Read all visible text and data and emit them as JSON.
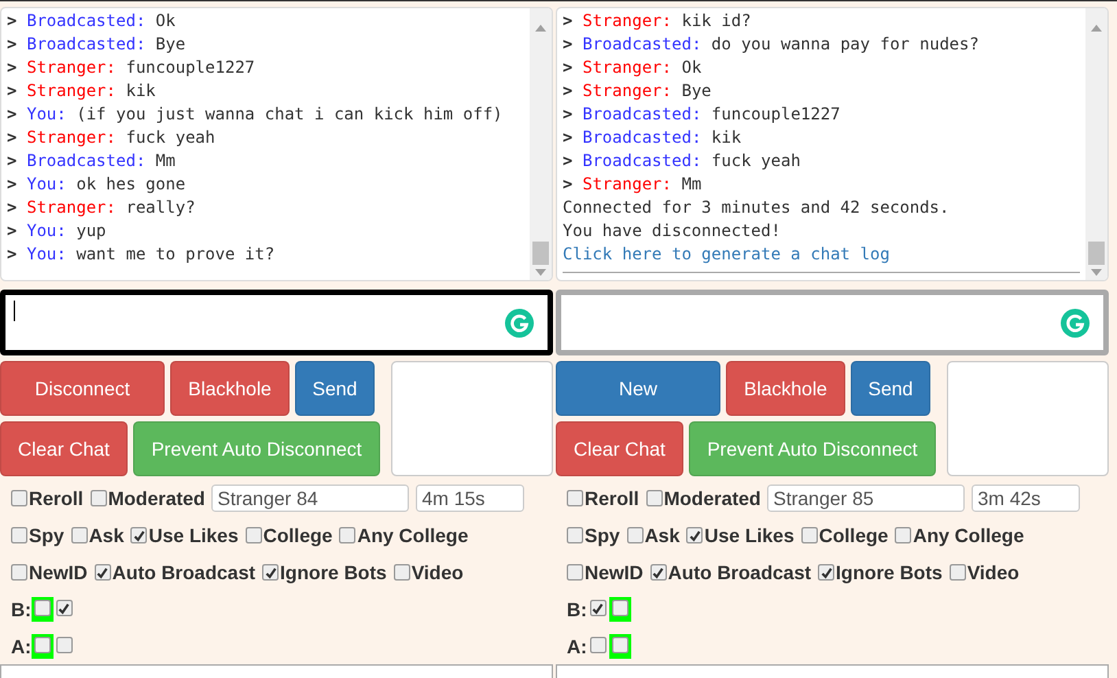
{
  "panels": [
    {
      "log": [
        {
          "kind": "broadcast",
          "prompt": ">",
          "sender": "Broadcasted:",
          "text": "Ok"
        },
        {
          "kind": "broadcast",
          "prompt": ">",
          "sender": "Broadcasted:",
          "text": "Bye"
        },
        {
          "kind": "stranger",
          "prompt": ">",
          "sender": "Stranger:",
          "text": "funcouple1227"
        },
        {
          "kind": "stranger",
          "prompt": ">",
          "sender": "Stranger:",
          "text": "kik"
        },
        {
          "kind": "you",
          "prompt": ">",
          "sender": "You:",
          "text": "(if you just wanna chat i can kick him off)"
        },
        {
          "kind": "stranger",
          "prompt": ">",
          "sender": "Stranger:",
          "text": "fuck yeah"
        },
        {
          "kind": "broadcast",
          "prompt": ">",
          "sender": "Broadcasted:",
          "text": "Mm"
        },
        {
          "kind": "you",
          "prompt": ">",
          "sender": "You:",
          "text": "ok hes gone"
        },
        {
          "kind": "stranger",
          "prompt": ">",
          "sender": "Stranger:",
          "text": "really?"
        },
        {
          "kind": "you",
          "prompt": ">",
          "sender": "You:",
          "text": "yup"
        },
        {
          "kind": "you",
          "prompt": ">",
          "sender": "You:",
          "text": "want me to prove it?"
        }
      ],
      "input": {
        "focused": true
      },
      "buttons_row1": [
        {
          "label": "Disconnect",
          "color": "#d9534f"
        },
        {
          "label": "Blackhole",
          "color": "#d9534f"
        },
        {
          "label": "Send",
          "color": "#337ab7"
        }
      ],
      "buttons_row2": [
        {
          "label": "Clear Chat",
          "color": "#d9534f"
        },
        {
          "label": "Prevent Auto Disconnect",
          "color": "#5cb85c"
        }
      ],
      "options_row1": [
        {
          "label": "Reroll",
          "checked": false
        },
        {
          "label": "Moderated",
          "checked": false
        }
      ],
      "name_field": "Stranger 84",
      "time_field": "4m 15s",
      "options_row2": [
        {
          "label": "Spy",
          "checked": false
        },
        {
          "label": "Ask",
          "checked": false
        },
        {
          "label": "Use Likes",
          "checked": true
        },
        {
          "label": "College",
          "checked": false
        },
        {
          "label": "Any College",
          "checked": false
        }
      ],
      "options_row3": [
        {
          "label": "NewID",
          "checked": false
        },
        {
          "label": "Auto Broadcast",
          "checked": true
        },
        {
          "label": "Ignore Bots",
          "checked": true
        },
        {
          "label": "Video",
          "checked": false
        }
      ],
      "links": [
        {
          "label": "B:",
          "boxes": [
            {
              "checked": false,
              "highlighted": true
            },
            {
              "checked": true,
              "highlighted": false
            }
          ]
        },
        {
          "label": "A:",
          "boxes": [
            {
              "checked": false,
              "highlighted": true
            },
            {
              "checked": false,
              "highlighted": false
            }
          ]
        }
      ]
    },
    {
      "log": [
        {
          "kind": "stranger",
          "prompt": ">",
          "sender": "Stranger:",
          "text": "kik id?"
        },
        {
          "kind": "broadcast",
          "prompt": ">",
          "sender": "Broadcasted:",
          "text": "do you wanna pay for nudes?"
        },
        {
          "kind": "stranger",
          "prompt": ">",
          "sender": "Stranger:",
          "text": "Ok"
        },
        {
          "kind": "stranger",
          "prompt": ">",
          "sender": "Stranger:",
          "text": "Bye"
        },
        {
          "kind": "broadcast",
          "prompt": ">",
          "sender": "Broadcasted:",
          "text": "funcouple1227"
        },
        {
          "kind": "broadcast",
          "prompt": ">",
          "sender": "Broadcasted:",
          "text": "kik"
        },
        {
          "kind": "broadcast",
          "prompt": ">",
          "sender": "Broadcasted:",
          "text": "fuck yeah"
        },
        {
          "kind": "stranger",
          "prompt": ">",
          "sender": "Stranger:",
          "text": "Mm"
        },
        {
          "kind": "status",
          "text": "Connected for 3 minutes and 42 seconds."
        },
        {
          "kind": "status",
          "text": "You have disconnected!"
        },
        {
          "kind": "link",
          "text": "Click here to generate a chat log"
        }
      ],
      "input": {
        "focused": false
      },
      "buttons_row1": [
        {
          "label": "New",
          "color": "#337ab7"
        },
        {
          "label": "Blackhole",
          "color": "#d9534f"
        },
        {
          "label": "Send",
          "color": "#337ab7"
        }
      ],
      "buttons_row2": [
        {
          "label": "Clear Chat",
          "color": "#d9534f"
        },
        {
          "label": "Prevent Auto Disconnect",
          "color": "#5cb85c"
        }
      ],
      "options_row1": [
        {
          "label": "Reroll",
          "checked": false
        },
        {
          "label": "Moderated",
          "checked": false
        }
      ],
      "name_field": "Stranger 85",
      "time_field": "3m 42s",
      "options_row2": [
        {
          "label": "Spy",
          "checked": false
        },
        {
          "label": "Ask",
          "checked": false
        },
        {
          "label": "Use Likes",
          "checked": true
        },
        {
          "label": "College",
          "checked": false
        },
        {
          "label": "Any College",
          "checked": false
        }
      ],
      "options_row3": [
        {
          "label": "NewID",
          "checked": false
        },
        {
          "label": "Auto Broadcast",
          "checked": true
        },
        {
          "label": "Ignore Bots",
          "checked": true
        },
        {
          "label": "Video",
          "checked": false
        }
      ],
      "links": [
        {
          "label": "B:",
          "boxes": [
            {
              "checked": true,
              "highlighted": false
            },
            {
              "checked": false,
              "highlighted": true
            }
          ]
        },
        {
          "label": "A:",
          "boxes": [
            {
              "checked": false,
              "highlighted": false
            },
            {
              "checked": false,
              "highlighted": true
            }
          ]
        }
      ]
    }
  ]
}
